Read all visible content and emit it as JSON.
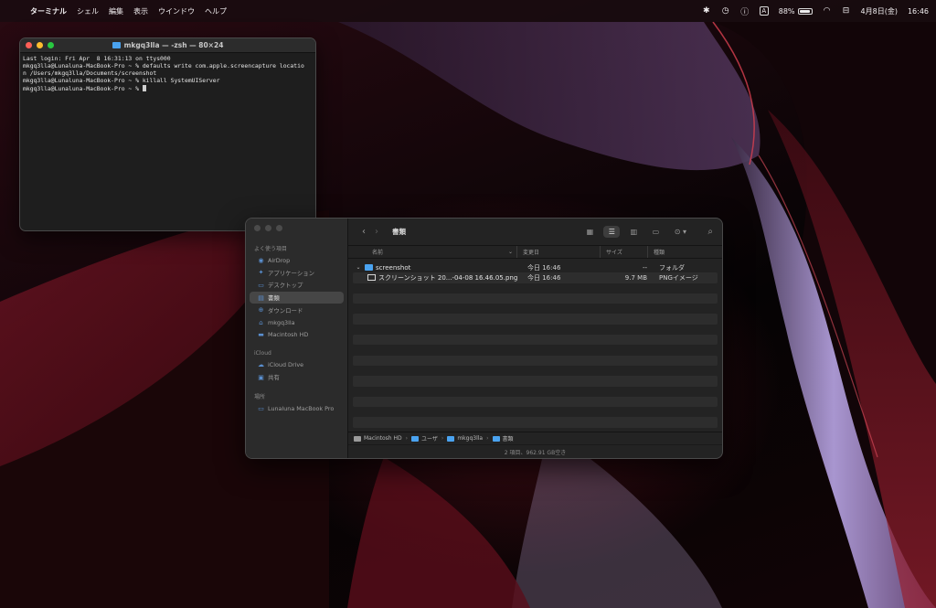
{
  "menubar": {
    "app_name": "ターミナル",
    "items": [
      "シェル",
      "編集",
      "表示",
      "ウインドウ",
      "ヘルプ"
    ],
    "input_indicator": "A",
    "battery_percent": "88%",
    "date": "4月8日(金)",
    "time": "16:46"
  },
  "terminal": {
    "title": "mkgq3lla — -zsh — 80×24",
    "lines": [
      "Last login: Fri Apr  8 16:31:13 on ttys000",
      "mkgq3lla@Lunaluna-MacBook-Pro ~ % defaults write com.apple.screencapture locatio",
      "n /Users/mkgq3lla/Documents/screenshot",
      "mkgq3lla@Lunaluna-MacBook-Pro ~ % killall SystemUIServer",
      "mkgq3lla@Lunaluna-MacBook-Pro ~ % "
    ]
  },
  "finder": {
    "toolbar_title": "書類",
    "sidebar": {
      "favorites_heading": "よく使う項目",
      "favorites": [
        {
          "label": "AirDrop",
          "icon": "airdrop-icon"
        },
        {
          "label": "アプリケーション",
          "icon": "applications-icon"
        },
        {
          "label": "デスクトップ",
          "icon": "desktop-icon"
        },
        {
          "label": "書類",
          "icon": "documents-icon",
          "active": true
        },
        {
          "label": "ダウンロード",
          "icon": "downloads-icon"
        },
        {
          "label": "mkgq3lla",
          "icon": "home-icon"
        },
        {
          "label": "Macintosh HD",
          "icon": "disk-icon"
        }
      ],
      "icloud_heading": "iCloud",
      "icloud": [
        {
          "label": "iCloud Drive",
          "icon": "cloud-icon"
        },
        {
          "label": "共有",
          "icon": "shared-icon"
        }
      ],
      "locations_heading": "場所",
      "locations": [
        {
          "label": "Lunaluna MacBook Pro",
          "icon": "laptop-icon"
        }
      ]
    },
    "columns": {
      "name": "名前",
      "date": "変更日",
      "size": "サイズ",
      "kind": "種類"
    },
    "rows": [
      {
        "name": "screenshot",
        "date": "今日 16:46",
        "size": "--",
        "kind": "フォルダ"
      },
      {
        "name": "スクリーンショット 20...-04-08 16.46.05.png",
        "date": "今日 16:46",
        "size": "9.7 MB",
        "kind": "PNGイメージ"
      }
    ],
    "path": [
      "Macintosh HD",
      "ユーザ",
      "mkgq3lla",
      "書類"
    ],
    "status": "2 項目、962.91 GB空き"
  },
  "colors": {
    "folder_blue": "#4aa3f0",
    "wallpaper_red": "#8a1828",
    "close_red": "#fe5f57",
    "minimize_yellow": "#febc2e",
    "zoom_green": "#28c840"
  }
}
